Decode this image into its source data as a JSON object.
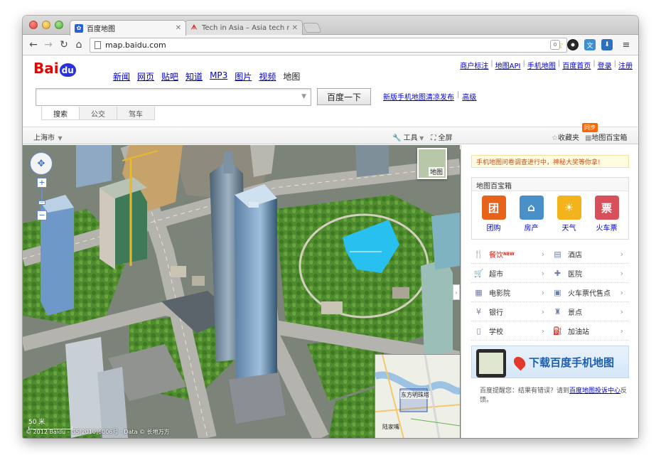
{
  "browser": {
    "tabs": [
      {
        "title": "百度地图",
        "icon": "baidu-paw-icon",
        "active": true
      },
      {
        "title": "Tech in Asia – Asia tech new",
        "icon": "techinasia-icon",
        "active": false
      }
    ],
    "url": "map.baidu.com"
  },
  "header": {
    "logo": {
      "bai": "Bai",
      "du": "du",
      "map": "地图"
    },
    "nav": [
      "新闻",
      "网页",
      "贴吧",
      "知道",
      "MP3",
      "图片",
      "视频"
    ],
    "nav_current": "地图",
    "top_links": [
      "商户标注",
      "地图API",
      "手机地图",
      "百度首页",
      "登录",
      "注册"
    ],
    "search": {
      "value": "",
      "button": "百度一下"
    },
    "news_link": "新版手机地图清凉发布",
    "advanced_link": "高级",
    "mode_tabs": [
      "搜索",
      "公交",
      "驾车"
    ],
    "mode_active": 0
  },
  "mapbar": {
    "city": "上海市",
    "tools": "工具",
    "fullscreen": "全屏",
    "favorites": "收藏夹",
    "treasure": "地图百宝箱",
    "sync_badge": "同步"
  },
  "map": {
    "thumb_label": "地图",
    "minimap_label": "东方明珠塔",
    "minimap_label2": "陆家嘴",
    "scale_label": "50 米",
    "copyright": "© 2012 Baidu - GS(2010)6006号 - Data © 长地万方"
  },
  "panel": {
    "notice": "手机地图问卷调查进行中，神秘大奖等你拿!",
    "box_title": "地图百宝箱",
    "apps": [
      {
        "label": "团购",
        "icon_text": "团",
        "color": "#e8631a"
      },
      {
        "label": "房产",
        "icon_text": "⌂",
        "color": "#4a90c8"
      },
      {
        "label": "天气",
        "icon_text": "☀",
        "color": "#f2b31c"
      },
      {
        "label": "火车票",
        "icon_text": "票",
        "color": "#d8505a"
      }
    ],
    "categories": [
      [
        {
          "label": "餐饮",
          "icon": "fork-knife-icon",
          "glyph": "🍴",
          "hot": true,
          "badge": "NEW"
        },
        {
          "label": "酒店",
          "icon": "hotel-icon",
          "glyph": "▤",
          "hot": false
        }
      ],
      [
        {
          "label": "超市",
          "icon": "cart-icon",
          "glyph": "🛒",
          "hot": false
        },
        {
          "label": "医院",
          "icon": "hospital-icon",
          "glyph": "✚",
          "hot": false
        }
      ],
      [
        {
          "label": "电影院",
          "icon": "film-icon",
          "glyph": "▦",
          "hot": false
        },
        {
          "label": "火车票代售点",
          "icon": "train-icon",
          "glyph": "▣",
          "hot": false
        }
      ],
      [
        {
          "label": "银行",
          "icon": "yen-icon",
          "glyph": "¥",
          "hot": false
        },
        {
          "label": "景点",
          "icon": "scenic-icon",
          "glyph": "♜",
          "hot": false
        }
      ],
      [
        {
          "label": "学校",
          "icon": "book-icon",
          "glyph": "▯",
          "hot": false
        },
        {
          "label": "加油站",
          "icon": "gas-icon",
          "glyph": "⛽",
          "hot": false
        }
      ]
    ],
    "download_text": "下载百度手机地图",
    "feedback_prefix": "百度提醒您：结果有错误？请到",
    "feedback_link": "百度地图投诉中心",
    "feedback_suffix": "反馈。"
  }
}
